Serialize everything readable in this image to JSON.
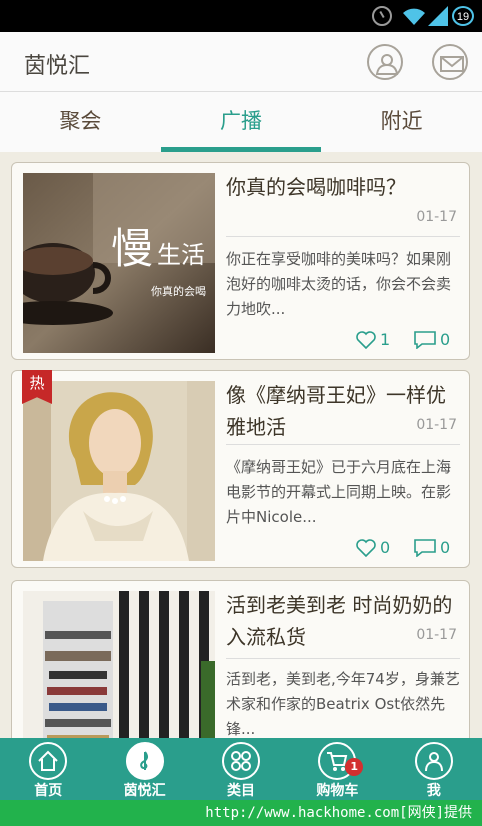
{
  "status_bar": {
    "battery_level": "19",
    "icons": [
      "alarm-icon",
      "wifi-icon",
      "signal-icon",
      "battery-icon"
    ]
  },
  "app_bar": {
    "title": "茵悦汇",
    "actions": [
      "profile-icon",
      "mail-icon"
    ]
  },
  "tabs": [
    {
      "label": "聚会",
      "active": false
    },
    {
      "label": "广播",
      "active": true
    },
    {
      "label": "附近",
      "active": false
    }
  ],
  "posts": [
    {
      "title": "你真的会喝咖啡吗？",
      "date": "01-17",
      "excerpt": "你正在享受咖啡的美味吗？如果刚泡好的咖啡太烫的话，你会不会卖力地吹...",
      "likes": "1",
      "comments": "0",
      "hot": false,
      "thumb_text": {
        "big": "慢",
        "mid": "生活",
        "small": "你真的会喝"
      }
    },
    {
      "title": "像《摩纳哥王妃》一样优雅地活",
      "date": "01-17",
      "excerpt": "《摩纳哥王妃》已于六月底在上海电影节的开幕式上同期上映。在影片中Nicole...",
      "likes": "0",
      "comments": "0",
      "hot": true,
      "hot_label": "热"
    },
    {
      "title": "活到老美到老 时尚奶奶的入流私货",
      "date": "01-17",
      "excerpt": "活到老，美到老,今年74岁，身兼艺术家和作家的Beatrix Ost依然先锋...",
      "hot": false
    }
  ],
  "bottom_nav": [
    {
      "label": "首页",
      "icon": "home-icon",
      "active": false
    },
    {
      "label": "茵悦汇",
      "icon": "music-note-icon",
      "active": true
    },
    {
      "label": "类目",
      "icon": "grid-icon",
      "active": false
    },
    {
      "label": "购物车",
      "icon": "cart-icon",
      "active": false,
      "badge": "1"
    },
    {
      "label": "我",
      "icon": "user-icon",
      "active": false
    }
  ],
  "watermark": "http://www.hackhome.com[网侠]提供",
  "colors": {
    "accent": "#2a9e8c",
    "background": "#efece2",
    "badge": "#d32f2f",
    "watermark_bg": "#22b24c"
  }
}
